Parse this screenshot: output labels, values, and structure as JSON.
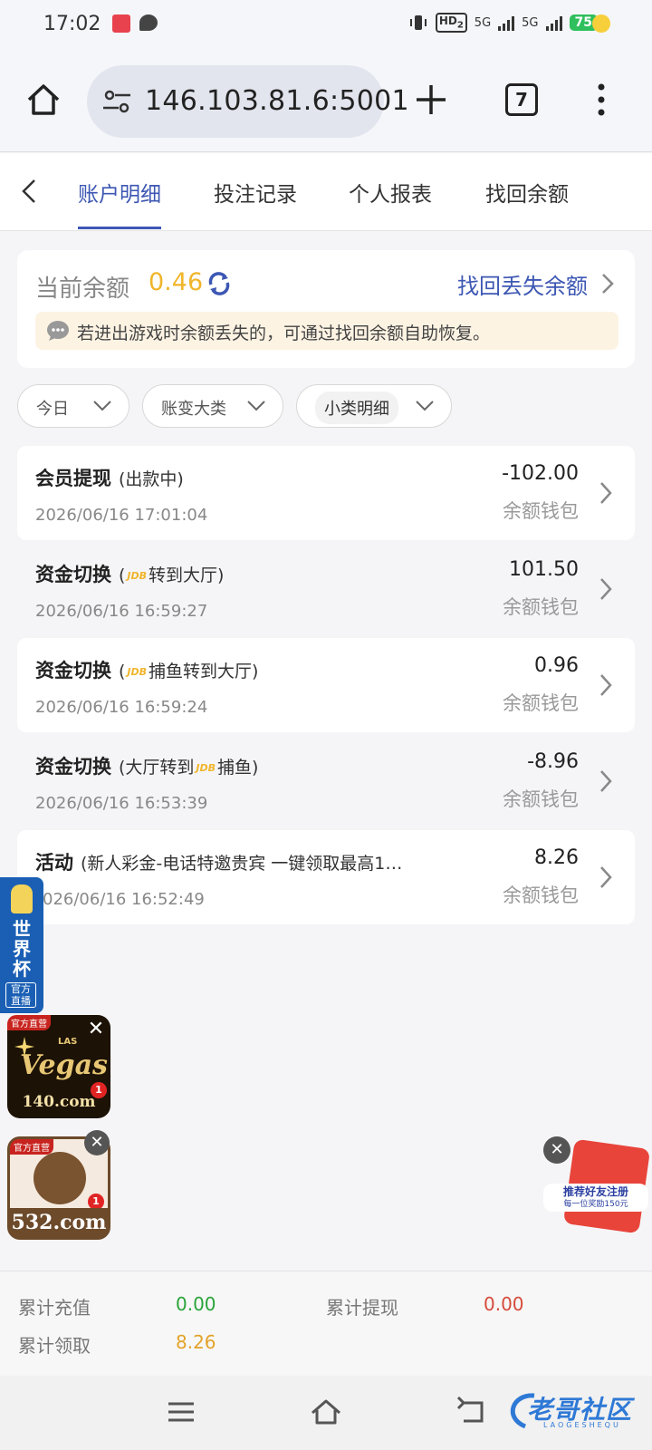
{
  "status_bar": {
    "time": "17:02",
    "network_hd": "HD",
    "network_hd_sub": "2",
    "signal1": "5G",
    "signal2": "5G",
    "battery": "75",
    "app_icons": [
      "app-notification-icon",
      "chat-bubble-icon"
    ]
  },
  "browser": {
    "url": "146.103.81.6:5001",
    "tab_count": "7"
  },
  "tabs": [
    {
      "label": "账户明细",
      "active": true
    },
    {
      "label": "投注记录",
      "active": false
    },
    {
      "label": "个人报表",
      "active": false
    },
    {
      "label": "找回余额",
      "active": false
    }
  ],
  "balance": {
    "label": "当前余额",
    "value": "0.46",
    "recover_link": "找回丢失余额",
    "notice": "若进出游戏时余额丢失的，可通过找回余额自助恢复。"
  },
  "filters": [
    {
      "label": "今日"
    },
    {
      "label": "账变大类"
    },
    {
      "label": "小类明细"
    }
  ],
  "records": [
    {
      "title": "会员提现",
      "detail": "(出款中)",
      "time": "2026/06/16 17:01:04",
      "amount": "-102.00",
      "wallet": "余额钱包"
    },
    {
      "title": "资金切换",
      "detail_pre": "(",
      "detail_post": "转到大厅)",
      "time": "2026/06/16 16:59:27",
      "amount": "101.50",
      "wallet": "余额钱包"
    },
    {
      "title": "资金切换",
      "detail_pre": "(",
      "detail_post": "捕鱼转到大厅)",
      "time": "2026/06/16 16:59:24",
      "amount": "0.96",
      "wallet": "余额钱包"
    },
    {
      "title": "资金切换",
      "detail_pre": "(大厅转到",
      "detail_post": "捕鱼)",
      "time": "2026/06/16 16:53:39",
      "amount": "-8.96",
      "wallet": "余额钱包"
    },
    {
      "title": "活动",
      "detail": "(新人彩金-电话特邀贵宾 一键领取最高1…",
      "time": "026/06/16 16:52:49",
      "amount": "8.26",
      "wallet": "余额钱包"
    }
  ],
  "jdb_logo": "JDB",
  "ads": {
    "worldcup": {
      "title": "世界杯",
      "live": "官方直播"
    },
    "vegas": {
      "tag": "官方直营",
      "brand": "Vegas",
      "brand_top": "LAS",
      "domain": "140.com",
      "badge": "1"
    },
    "site532": {
      "tag": "官方直营",
      "domain": "532.com",
      "badge": "1"
    },
    "referral": {
      "line1": "推荐好友注册",
      "line2": "每一位奖励150元"
    }
  },
  "summary": {
    "recharge_label": "累计充值",
    "recharge_value": "0.00",
    "withdraw_label": "累计提现",
    "withdraw_value": "0.00",
    "claim_label": "累计领取",
    "claim_value": "8.26"
  },
  "watermark": {
    "text": "老哥社区",
    "sub": "LAOGESHEQU"
  },
  "colors": {
    "accent": "#3d57b3",
    "balance": "#f0b52b",
    "green": "#2aa43a",
    "red": "#d64a3b",
    "gold": "#e3a32a"
  }
}
